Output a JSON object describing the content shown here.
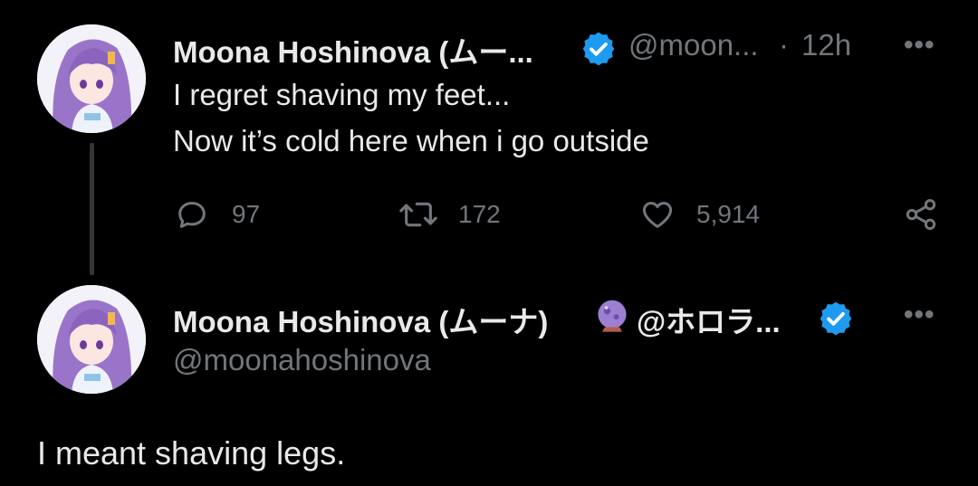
{
  "tweet1": {
    "author_name": "Moona Hoshinova (ムー...",
    "handle": "@moon...",
    "separator": "·",
    "time": "12h",
    "line1": "I regret shaving my feet...",
    "line2": "Now it’s cold here when i go outside",
    "replies": "97",
    "retweets": "172",
    "likes": "5,914"
  },
  "tweet2": {
    "author_name": "Moona Hoshinova (ムーナ)",
    "author_name_suffix": "@ホロラ...",
    "handle": "@moonahoshinova",
    "text": "I meant shaving legs."
  },
  "icons": {
    "verified": "verified-badge-icon",
    "crystal_ball": "crystal-ball-icon",
    "reply": "reply-icon",
    "retweet": "retweet-icon",
    "like": "heart-icon",
    "share": "share-icon",
    "more": "more-icon"
  },
  "colors": {
    "verified_blue": "#1d9bf0",
    "text_primary": "#e7e9ea",
    "text_secondary": "#71767b",
    "background": "#000000"
  }
}
